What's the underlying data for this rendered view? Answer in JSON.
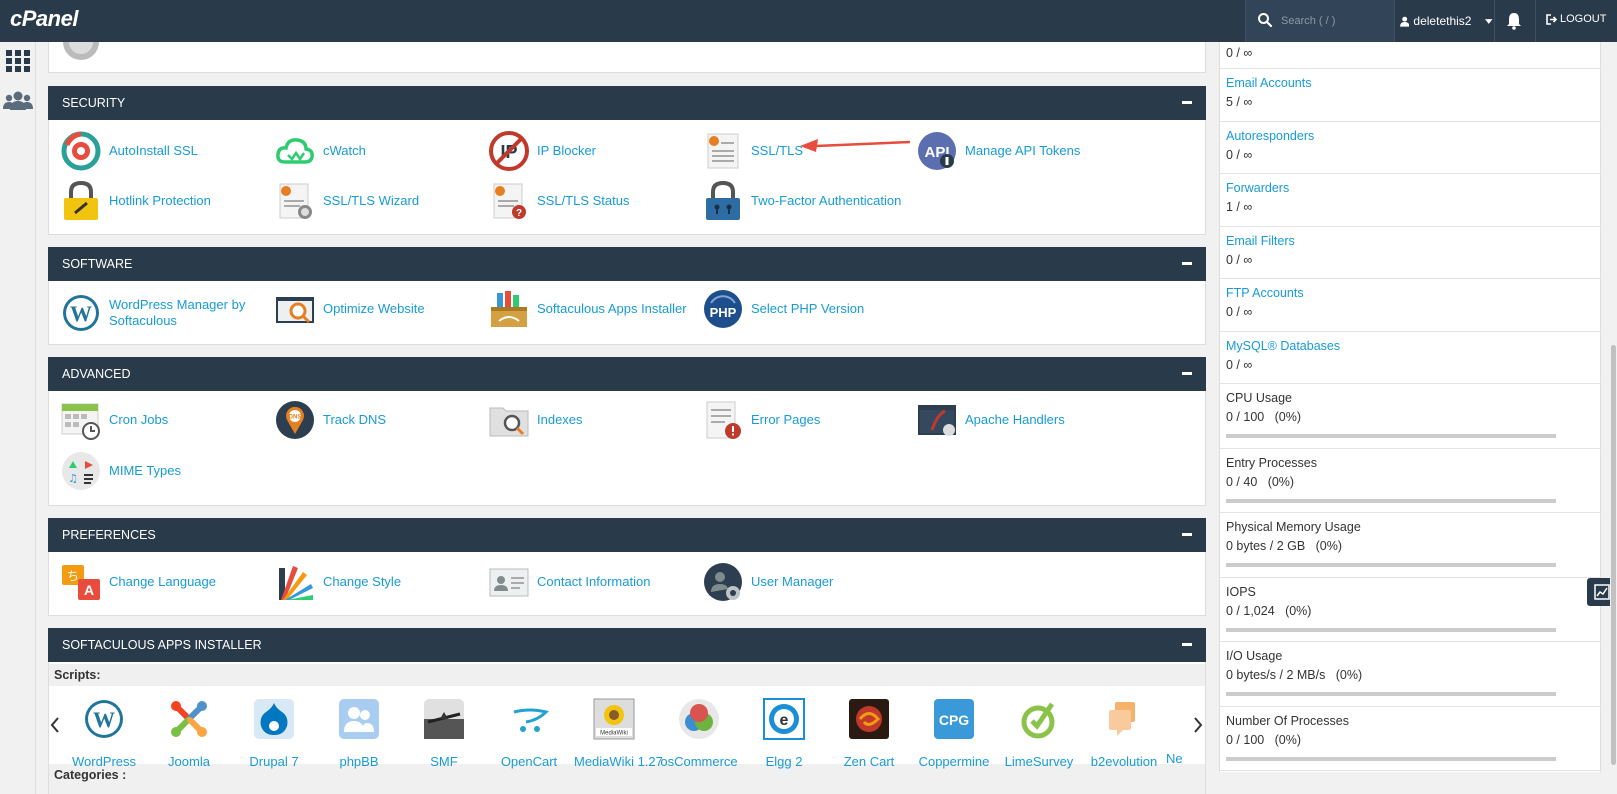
{
  "topbar": {
    "logo": "cPanel",
    "search_placeholder": "Search ( / )",
    "username": "deletethis2",
    "logout": "LOGOUT"
  },
  "sections": {
    "security": {
      "title": "SECURITY",
      "items": [
        "AutoInstall SSL",
        "cWatch",
        "IP Blocker",
        "SSL/TLS",
        "Manage API Tokens",
        "Hotlink Protection",
        "SSL/TLS Wizard",
        "SSL/TLS Status",
        "Two-Factor Authentication"
      ]
    },
    "software": {
      "title": "SOFTWARE",
      "items": [
        "WordPress Manager by Softaculous",
        "Optimize Website",
        "Softaculous Apps Installer",
        "Select PHP Version"
      ]
    },
    "advanced": {
      "title": "ADVANCED",
      "items": [
        "Cron Jobs",
        "Track DNS",
        "Indexes",
        "Error Pages",
        "Apache Handlers",
        "MIME Types"
      ]
    },
    "preferences": {
      "title": "PREFERENCES",
      "items": [
        "Change Language",
        "Change Style",
        "Contact Information",
        "User Manager"
      ]
    },
    "softaculous": {
      "title": "SOFTACULOUS APPS INSTALLER",
      "scripts_label": "Scripts:",
      "categories_label": "Categories :",
      "apps": [
        "WordPress",
        "Joomla",
        "Drupal 7",
        "phpBB",
        "SMF",
        "OpenCart",
        "MediaWiki 1.27",
        "osCommerce",
        "Elgg 2",
        "Zen Cart",
        "Coppermine",
        "LimeSurvey",
        "b2evolution",
        "Ne"
      ]
    }
  },
  "stats": {
    "top_value": "0 / ∞",
    "links": [
      {
        "label": "Email Accounts",
        "value": "5 / ∞"
      },
      {
        "label": "Autoresponders",
        "value": "0 / ∞"
      },
      {
        "label": "Forwarders",
        "value": "1 / ∞"
      },
      {
        "label": "Email Filters",
        "value": "0 / ∞"
      },
      {
        "label": "FTP Accounts",
        "value": "0 / ∞"
      },
      {
        "label": "MySQL® Databases",
        "value": "0 / ∞"
      }
    ],
    "usage": [
      {
        "label": "CPU Usage",
        "value": "0 / 100   (0%)",
        "percent": 0
      },
      {
        "label": "Entry Processes",
        "value": "0 / 40   (0%)",
        "percent": 0
      },
      {
        "label": "Physical Memory Usage",
        "value": "0 bytes / 2 GB   (0%)",
        "percent": 0
      },
      {
        "label": "IOPS",
        "value": "0 / 1,024   (0%)",
        "percent": 0
      },
      {
        "label": "I/O Usage",
        "value": "0 bytes/s / 2 MB/s   (0%)",
        "percent": 0
      },
      {
        "label": "Number Of Processes",
        "value": "0 / 100   (0%)",
        "percent": 0
      }
    ]
  },
  "colors": {
    "header": "#293a4a",
    "link": "#179bd7",
    "arrow": "#e74c3c"
  }
}
